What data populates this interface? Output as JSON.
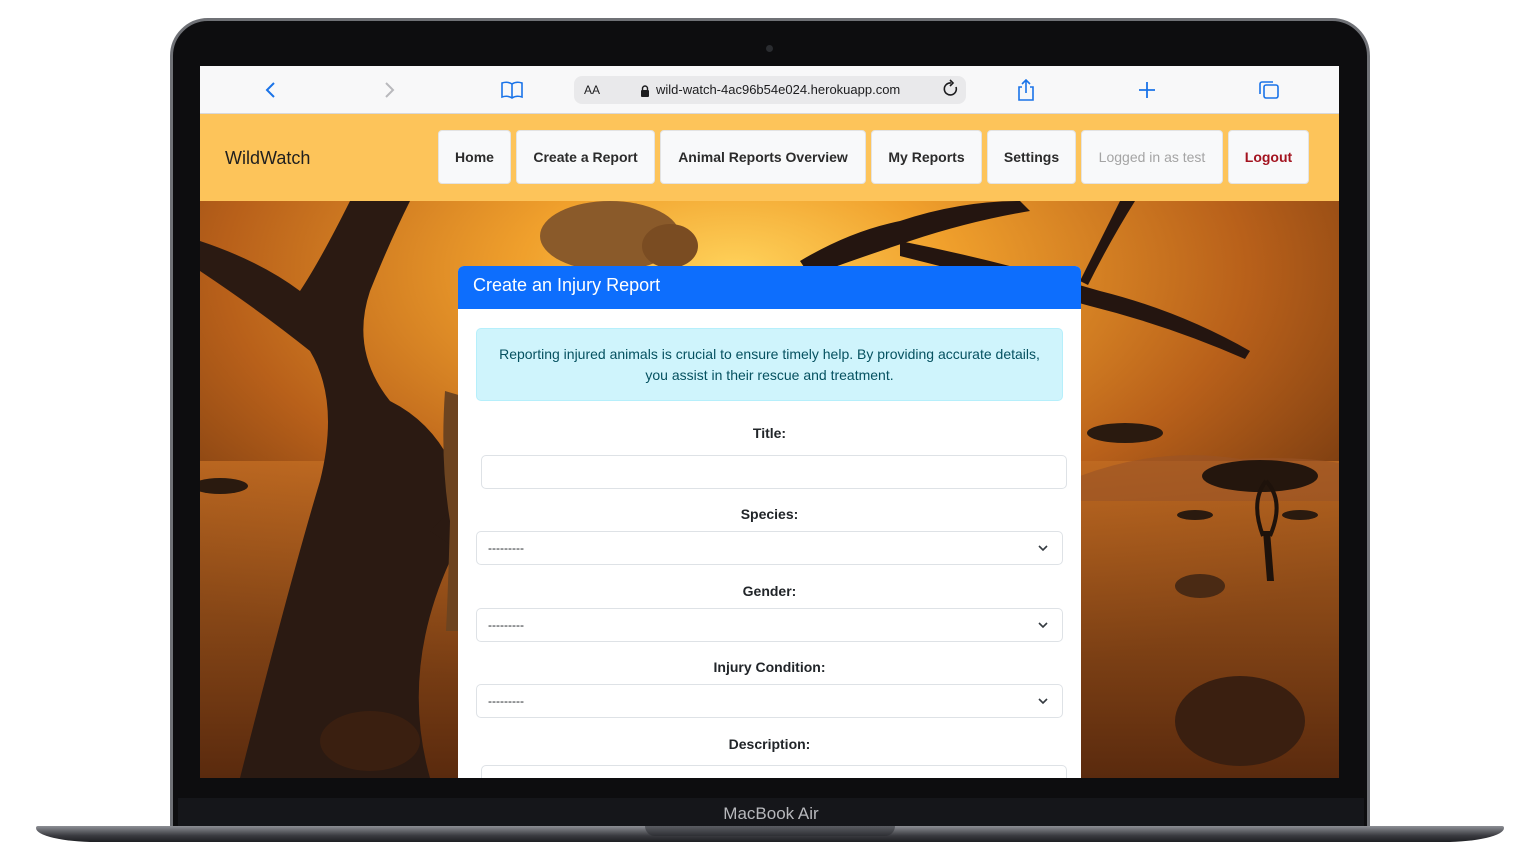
{
  "device": {
    "label": "MacBook Air"
  },
  "browser": {
    "reader_label": "AA",
    "url": "wild-watch-4ac96b54e024.herokuapp.com"
  },
  "navbar": {
    "brand": "WildWatch",
    "items": [
      {
        "label": "Home"
      },
      {
        "label": "Create a Report"
      },
      {
        "label": "Animal Reports Overview"
      },
      {
        "label": "My Reports"
      },
      {
        "label": "Settings"
      },
      {
        "label": "Logged in as test"
      },
      {
        "label": "Logout"
      }
    ]
  },
  "form": {
    "header": "Create an Injury Report",
    "info": "Reporting injured animals is crucial to ensure timely help. By providing accurate details, you assist in their rescue and treatment.",
    "title_label": "Title:",
    "title_value": "",
    "species_label": "Species:",
    "species_value": "---------",
    "gender_label": "Gender:",
    "gender_value": "---------",
    "injury_label": "Injury Condition:",
    "injury_value": "---------",
    "description_label": "Description:"
  },
  "colors": {
    "navbar": "#fdc45a",
    "primary": "#0d6efd",
    "alert_bg": "#cff4fc",
    "logout": "#a3131f"
  }
}
